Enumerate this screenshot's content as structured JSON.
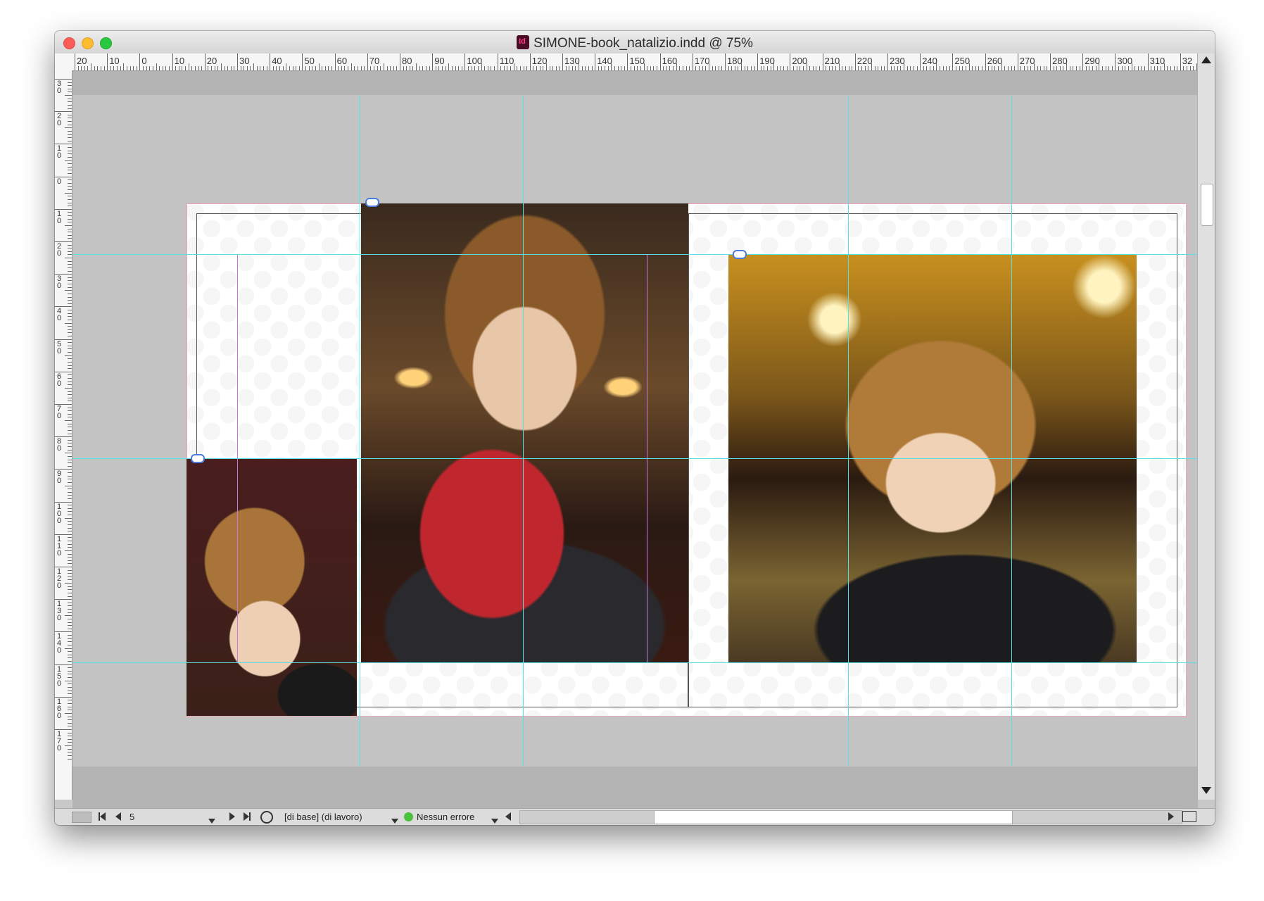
{
  "window": {
    "title": "SIMONE-book_natalizio.indd @ 75%",
    "app_icon": "indesign-icon"
  },
  "ruler_h_labels": [
    "20",
    "10",
    "0",
    "10",
    "20",
    "30",
    "40",
    "50",
    "60",
    "70",
    "80",
    "90",
    "100",
    "110",
    "120",
    "130",
    "140",
    "150",
    "160",
    "170",
    "180",
    "190",
    "200",
    "210",
    "220",
    "230",
    "240",
    "250",
    "260",
    "270",
    "280",
    "290",
    "300",
    "310",
    "32"
  ],
  "ruler_v_labels": [
    "3\n0",
    "2\n0",
    "1\n0",
    "0",
    "1\n0",
    "2\n0",
    "3\n0",
    "4\n0",
    "5\n0",
    "6\n0",
    "7\n0",
    "8\n0",
    "9\n0",
    "1\n0\n0",
    "1\n1\n0",
    "1\n2\n0",
    "1\n3\n0",
    "1\n4\n0",
    "1\n5\n0",
    "1\n6\n0",
    "1\n7\n0"
  ],
  "statusbar": {
    "page_number": "5",
    "master_label": "[di base] (di lavoro)",
    "preflight_label": "Nessun errore",
    "preflight_color": "#4cc23c"
  },
  "colors": {
    "guide": "#5bdde6",
    "margin_guide": "#c57ad8",
    "bleed": "#f0a0b0"
  }
}
